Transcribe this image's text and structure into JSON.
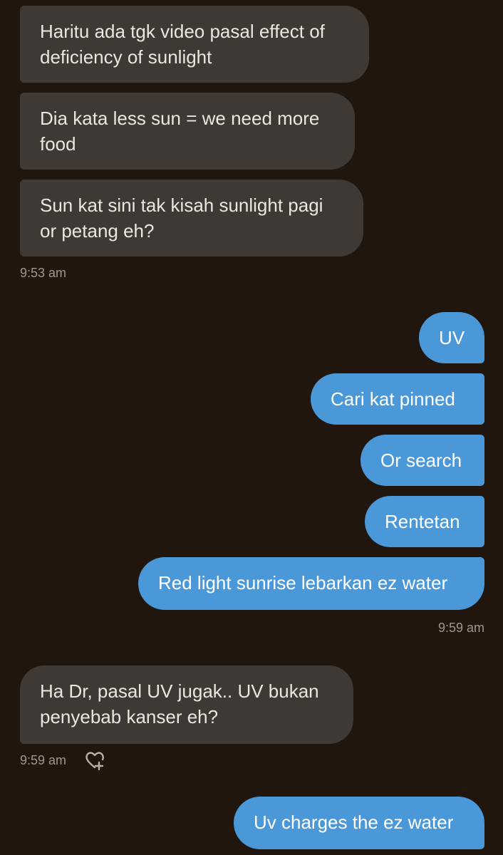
{
  "messages": [
    {
      "text": "Haritu ada tgk video pasal effect of\ndeficiency of sunlight"
    },
    {
      "text": "Dia kata less sun = we need more\nfood"
    },
    {
      "text": "Sun kat sini tak kisah sunlight pagi\nor petang eh?"
    },
    {
      "text": "UV"
    },
    {
      "text": "Cari kat pinned"
    },
    {
      "text": "Or search"
    },
    {
      "text": "Rentetan"
    },
    {
      "text": "Red light sunrise lebarkan ez water"
    },
    {
      "text": "Ha Dr, pasal UV jugak.. UV bukan\npenyebab kanser eh?"
    },
    {
      "text": "Uv charges the ez water"
    }
  ],
  "timestamps": {
    "incoming_1": "9:53 am",
    "outgoing_1": "9:59 am",
    "incoming_2": "9:59 am"
  },
  "icons": {
    "reaction": "heart-plus-icon"
  },
  "colors": {
    "background": "#21160e",
    "incoming_bubble": "#3e3935",
    "outgoing_bubble": "#4b98d9"
  }
}
